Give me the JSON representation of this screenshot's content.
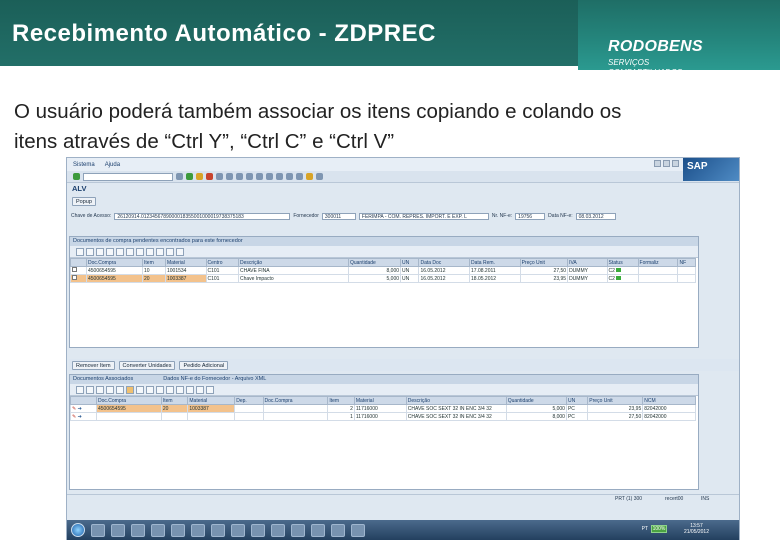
{
  "slide": {
    "title": "Recebimento Automático - ZDPREC",
    "logo_name": "RODOBENS",
    "logo_sub_1": "SERVIÇOS",
    "logo_sub_2": "COMPARTILHADOS",
    "intro_line1": "O usuário poderá também associar os itens copiando e colando os",
    "intro_line2": "itens através de “Ctrl Y”, “Ctrl C” e “Ctrl V”",
    "colors": {
      "header": "#1f6e66",
      "title_text": "#ffffff"
    }
  },
  "sap": {
    "menu": [
      "Sistema",
      "Ajuda"
    ],
    "logo": "SAP",
    "app_title": "ALV",
    "app_button": "Popup",
    "form": {
      "chave_label": "Chave de Acesso:",
      "chave_value": "26120914.0123456789000018355001000019738375183",
      "fornecedor_label": "Fornecedor",
      "fornecedor_value": "300011",
      "fornecedor_name": "FERIMPA - COM. REPRES. IMPORT. E EXP. L",
      "nf_label": "Nr. NF-e:",
      "nf_value": "19756",
      "data_label": "Data NF-e:",
      "data_value": "08.03.2012"
    },
    "top_panel": {
      "title": "Documentos de compra pendentes encontrados para este fornecedor",
      "columns": [
        "",
        "Doc.Compra",
        "Item",
        "Material",
        "Centro",
        "Descrição",
        "Quantidade",
        "UN",
        "Data Doc",
        "Data Rem.",
        "Preço Unit",
        "IVA",
        "Status",
        "Formaliz",
        "NF"
      ],
      "rows": [
        {
          "doc": "4500654595",
          "item": "10",
          "material": "1001534",
          "centro": "C101",
          "descricao": "CHAVE FINA",
          "qtd": "8,000",
          "un": "UN",
          "data_doc": "16.05.2012",
          "data_rem": "17.08.2011",
          "preco": "27,50",
          "iva": "DUMMY",
          "status": "C2"
        },
        {
          "doc": "4500654595",
          "item": "20",
          "material": "1003387",
          "centro": "C101",
          "descricao": "Chave Impacto",
          "qtd": "5,000",
          "un": "UN",
          "data_doc": "16.05.2012",
          "data_rem": "18.05.2012",
          "preco": "23,95",
          "iva": "DUMMY",
          "status": "C2"
        }
      ]
    },
    "split": {
      "btn1": "Remover Item",
      "btn2": "Converter Unidades",
      "btn3": "Pedido Adicional"
    },
    "bottom_panel": {
      "title_left": "Documentos Associados",
      "title_right": "Dados NF-e do Fornecedor - Arquivo XML",
      "left_columns": [
        "",
        "Doc.Compra",
        "Item",
        "Material",
        "Dep.",
        "Doc.Compra",
        "Item"
      ],
      "right_columns": [
        "Material",
        "Descrição",
        "Quantidade",
        "UN",
        "Preço Unit",
        "NCM"
      ],
      "rows": [
        {
          "doc": "4500654595",
          "item": "20",
          "material": "1003387",
          "r_item": "2",
          "r_mat": "11716000",
          "r_desc": "CHAVE SOC SEXT 32 IN ENC 3/4 32",
          "r_qtd": "5,000",
          "r_un": "PC",
          "r_preco": "23,95",
          "r_ncm": "82042000"
        },
        {
          "doc": "",
          "item": "",
          "material": "",
          "r_item": "1",
          "r_mat": "11716000",
          "r_desc": "CHAVE SOC SEXT 32 IN ENC 3/4 32",
          "r_qtd": "8,000",
          "r_un": "PC",
          "r_preco": "27,50",
          "r_ncm": "82042000"
        }
      ]
    },
    "status": {
      "system": "PRT (1) 300",
      "user": "recert00",
      "mode": "INS"
    },
    "taskbar": {
      "lang": "PT",
      "battery": "100%",
      "time": "13:57",
      "date": "21/05/2012"
    }
  }
}
